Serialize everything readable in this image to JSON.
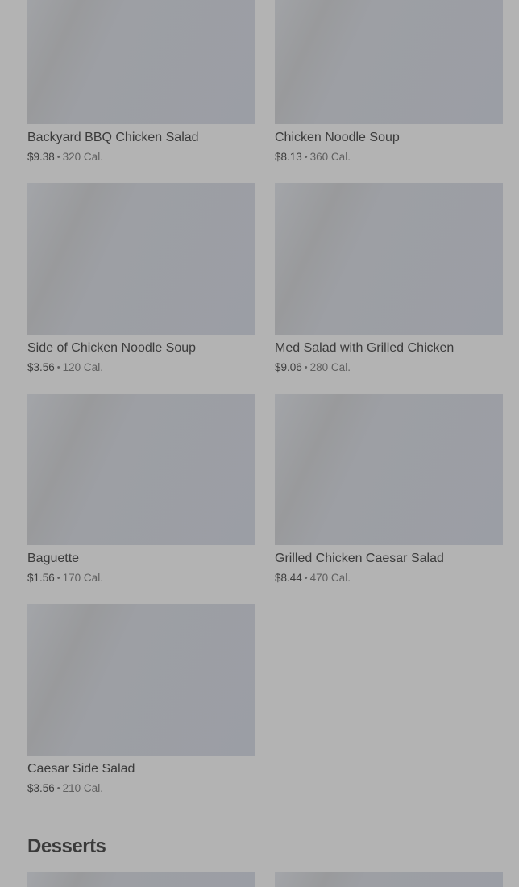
{
  "menu": {
    "items": [
      {
        "name": "Backyard BBQ Chicken Salad",
        "price": "$9.38",
        "calories": "320 Cal."
      },
      {
        "name": "Chicken Noodle Soup",
        "price": "$8.13",
        "calories": "360 Cal."
      },
      {
        "name": "Side of Chicken Noodle Soup",
        "price": "$3.56",
        "calories": "120 Cal."
      },
      {
        "name": "Med Salad with Grilled Chicken",
        "price": "$9.06",
        "calories": "280 Cal."
      },
      {
        "name": "Baguette",
        "price": "$1.56",
        "calories": "170 Cal."
      },
      {
        "name": "Grilled Chicken Caesar Salad",
        "price": "$8.44",
        "calories": "470 Cal."
      },
      {
        "name": "Caesar Side Salad",
        "price": "$3.56",
        "calories": "210 Cal."
      }
    ],
    "separator": "•"
  },
  "desserts": {
    "title": "Desserts"
  }
}
